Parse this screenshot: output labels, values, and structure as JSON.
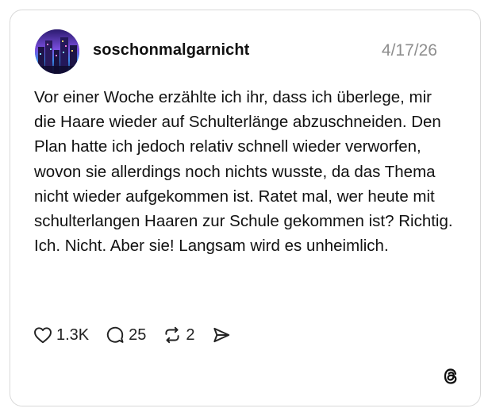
{
  "post": {
    "username": "soschonmalgarnicht",
    "date": "4/17/26",
    "text": "Vor einer Woche erzählte ich ihr, dass ich überlege, mir die Haare wieder auf Schulterlänge abzuschneiden. Den Plan hatte ich jedoch relativ schnell wieder verworfen, wovon sie allerdings noch nichts wusste, da das Thema nicht wieder aufgekommen ist. Ratet mal, wer heute mit schulterlangen Haaren zur Schule gekommen ist? Richtig. Ich. Nicht. Aber sie! Langsam wird es unheimlich."
  },
  "actions": {
    "likes": "1.3K",
    "replies": "25",
    "reposts": "2"
  },
  "icons": {
    "like": "heart-icon",
    "reply": "speech-bubble-icon",
    "repost": "repost-icon",
    "share": "send-icon",
    "brand": "threads-logo-icon"
  }
}
